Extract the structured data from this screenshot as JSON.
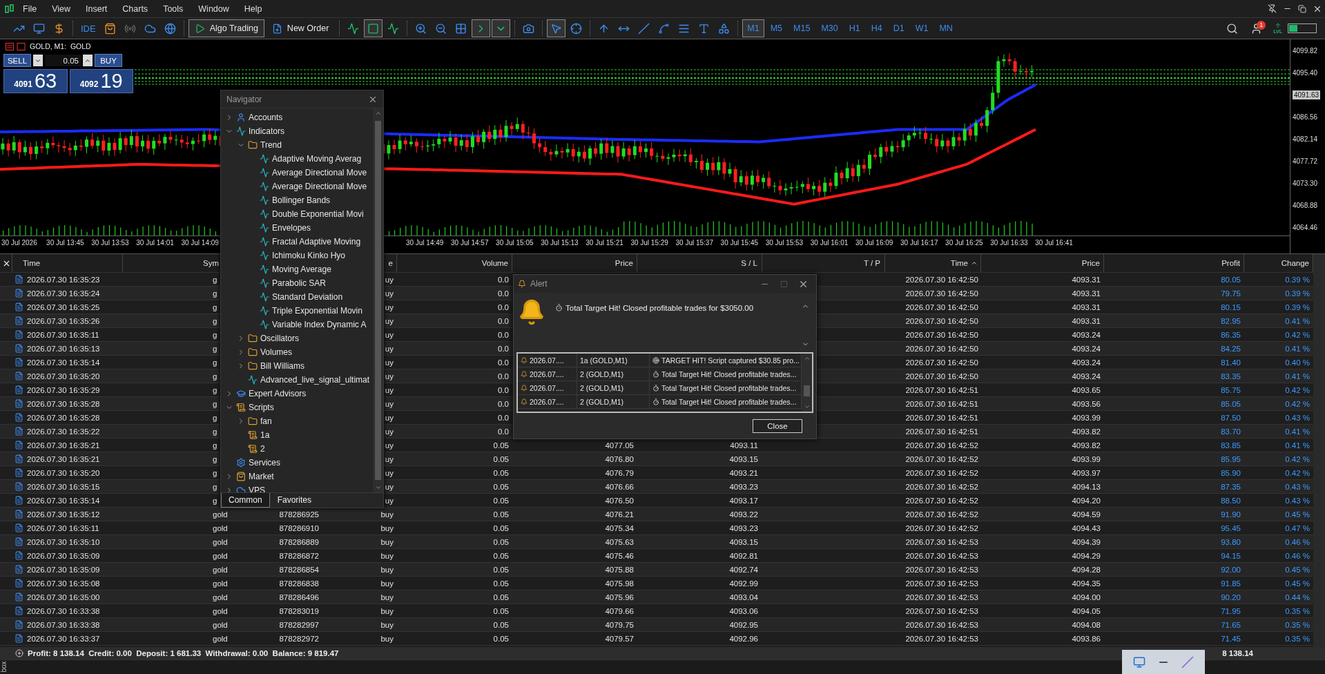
{
  "menu": [
    "File",
    "View",
    "Insert",
    "Charts",
    "Tools",
    "Window",
    "Help"
  ],
  "toolbar": {
    "ide": "IDE",
    "algo_trading": {
      "label": "Algo Trading",
      "on": true
    },
    "new_order": "New Order",
    "toggles": {
      "candles": true,
      "autoscroll": true,
      "chart_shift": true,
      "cursor": true
    },
    "timeframes": [
      {
        "label": "M1",
        "selected": true
      },
      {
        "label": "M5",
        "selected": false
      },
      {
        "label": "M15",
        "selected": false
      },
      {
        "label": "M30",
        "selected": false
      },
      {
        "label": "H1",
        "selected": false
      },
      {
        "label": "H4",
        "selected": false
      },
      {
        "label": "D1",
        "selected": false
      },
      {
        "label": "W1",
        "selected": false
      },
      {
        "label": "MN",
        "selected": false
      }
    ],
    "notifications": "1",
    "lvl": "LVL"
  },
  "chart": {
    "title": "GOLD, M1:  GOLD",
    "trade_panel": {
      "sell": "SELL",
      "buy": "BUY",
      "volume": "0.05",
      "bid_big": "4091",
      "bid_small": "63",
      "ask_big": "4092",
      "ask_small": "19"
    },
    "price_labels": [
      {
        "kind": "tick",
        "text": "4099.82"
      },
      {
        "kind": "tick",
        "text": "4095.40"
      },
      {
        "kind": "current",
        "text": "4091.63"
      },
      {
        "kind": "tick",
        "text": "4086.56"
      },
      {
        "kind": "tick",
        "text": "4082.14"
      },
      {
        "kind": "tick",
        "text": "4077.72"
      },
      {
        "kind": "tick",
        "text": "4073.30"
      },
      {
        "kind": "tick",
        "text": "4068.88"
      },
      {
        "kind": "tick",
        "text": "4064.46"
      }
    ],
    "time_labels": [
      "30 Jul 2026",
      "30 Jul 13:45",
      "30 Jul 13:53",
      "30 Jul 14:01",
      "30 Jul 14:09",
      "30 Jul 14:49",
      "30 Jul 14:57",
      "30 Jul 15:05",
      "30 Jul 15:13",
      "30 Jul 15:21",
      "30 Jul 15:29",
      "30 Jul 15:37",
      "30 Jul 15:45",
      "30 Jul 15:53",
      "30 Jul 16:01",
      "30 Jul 16:09",
      "30 Jul 16:17",
      "30 Jul 16:25",
      "30 Jul 16:33",
      "30 Jul 16:41"
    ]
  },
  "navigator": {
    "title": "Navigator",
    "tabs": [
      {
        "label": "Common",
        "selected": true
      },
      {
        "label": "Favorites",
        "selected": false
      }
    ],
    "items": [
      {
        "label": "Accounts",
        "kind": "accounts",
        "expanded": false
      },
      {
        "label": "Indicators",
        "kind": "indicator",
        "expanded": true,
        "children": [
          {
            "label": "Trend",
            "kind": "folder",
            "expanded": true,
            "children": [
              {
                "label": "Adaptive Moving Averag",
                "kind": "indicator"
              },
              {
                "label": "Average Directional Move",
                "kind": "indicator"
              },
              {
                "label": "Average Directional Move",
                "kind": "indicator"
              },
              {
                "label": "Bollinger Bands",
                "kind": "indicator"
              },
              {
                "label": "Double Exponential Movi",
                "kind": "indicator"
              },
              {
                "label": "Envelopes",
                "kind": "indicator"
              },
              {
                "label": "Fractal Adaptive Moving",
                "kind": "indicator"
              },
              {
                "label": "Ichimoku Kinko Hyo",
                "kind": "indicator"
              },
              {
                "label": "Moving Average",
                "kind": "indicator"
              },
              {
                "label": "Parabolic SAR",
                "kind": "indicator"
              },
              {
                "label": "Standard Deviation",
                "kind": "indicator"
              },
              {
                "label": "Triple Exponential Movin",
                "kind": "indicator"
              },
              {
                "label": "Variable Index Dynamic A",
                "kind": "indicator"
              }
            ]
          },
          {
            "label": "Oscillators",
            "kind": "folder",
            "expanded": false
          },
          {
            "label": "Volumes",
            "kind": "folder",
            "expanded": false
          },
          {
            "label": "Bill Williams",
            "kind": "folder",
            "expanded": false
          },
          {
            "label": "Advanced_live_signal_ultimat",
            "kind": "indicator"
          }
        ]
      },
      {
        "label": "Expert Advisors",
        "kind": "experts",
        "expanded": false
      },
      {
        "label": "Scripts",
        "kind": "script",
        "expanded": true,
        "children": [
          {
            "label": "fan",
            "kind": "folder",
            "expanded": false
          },
          {
            "label": "1a",
            "kind": "script"
          },
          {
            "label": "2",
            "kind": "script"
          }
        ]
      },
      {
        "label": "Services",
        "kind": "services"
      },
      {
        "label": "Market",
        "kind": "market",
        "expanded": false
      },
      {
        "label": "VPS",
        "kind": "vps",
        "expanded": false
      }
    ]
  },
  "alert": {
    "title": "Alert",
    "message": "Total Target Hit! Closed profitable trades for $3050.00",
    "close": "Close",
    "log": [
      {
        "time": "2026.07....",
        "source": "1a (GOLD,M1)",
        "kind": "target",
        "message": "TARGET HIT! Script captured $30.85 pro..."
      },
      {
        "time": "2026.07....",
        "source": "2 (GOLD,M1)",
        "kind": "timer",
        "message": "Total Target Hit! Closed profitable trades..."
      },
      {
        "time": "2026.07....",
        "source": "2 (GOLD,M1)",
        "kind": "timer",
        "message": "Total Target Hit! Closed profitable trades..."
      },
      {
        "time": "2026.07....",
        "source": "2 (GOLD,M1)",
        "kind": "timer",
        "message": "Total Target Hit! Closed profitable trades..."
      }
    ]
  },
  "table": {
    "columns": [
      {
        "label": "Time",
        "sorted": false
      },
      {
        "label": "Sym",
        "sorted": false
      },
      {
        "label": "e",
        "sorted": false
      },
      {
        "label": "Volume",
        "sorted": false
      },
      {
        "label": "Price",
        "sorted": false
      },
      {
        "label": "S / L",
        "sorted": false
      },
      {
        "label": "T / P",
        "sorted": false
      },
      {
        "label": "Time",
        "sorted": true
      },
      {
        "label": "Price",
        "sorted": false
      },
      {
        "label": "Profit",
        "sorted": false
      },
      {
        "label": "Change",
        "sorted": false
      }
    ],
    "rows": [
      {
        "time": "2026.07.30 16:35:23",
        "symbol": "g",
        "type": "uy",
        "volume": "0.0",
        "close_time": "2026.07.30 16:42:50",
        "close_price": "4093.31",
        "profit": "80.05",
        "change": "0.39 %"
      },
      {
        "time": "2026.07.30 16:35:24",
        "symbol": "g",
        "type": "uy",
        "volume": "0.0",
        "close_time": "2026.07.30 16:42:50",
        "close_price": "4093.31",
        "profit": "79.75",
        "change": "0.39 %"
      },
      {
        "time": "2026.07.30 16:35:25",
        "symbol": "g",
        "type": "uy",
        "volume": "0.0",
        "close_time": "2026.07.30 16:42:50",
        "close_price": "4093.31",
        "profit": "80.15",
        "change": "0.39 %"
      },
      {
        "time": "2026.07.30 16:35:26",
        "symbol": "g",
        "type": "uy",
        "volume": "0.0",
        "close_time": "2026.07.30 16:42:50",
        "close_price": "4093.31",
        "profit": "82.95",
        "change": "0.41 %"
      },
      {
        "time": "2026.07.30 16:35:11",
        "symbol": "g",
        "type": "uy",
        "volume": "0.0",
        "close_time": "2026.07.30 16:42:50",
        "close_price": "4093.24",
        "profit": "86.35",
        "change": "0.42 %"
      },
      {
        "time": "2026.07.30 16:35:13",
        "symbol": "g",
        "type": "uy",
        "volume": "0.0",
        "close_time": "2026.07.30 16:42:50",
        "close_price": "4093.24",
        "profit": "84.25",
        "change": "0.41 %"
      },
      {
        "time": "2026.07.30 16:35:14",
        "symbol": "g",
        "type": "uy",
        "volume": "0.0",
        "close_time": "2026.07.30 16:42:50",
        "close_price": "4093.24",
        "profit": "81.40",
        "change": "0.40 %"
      },
      {
        "time": "2026.07.30 16:35:20",
        "symbol": "g",
        "type": "uy",
        "volume": "0.0",
        "close_time": "2026.07.30 16:42:50",
        "close_price": "4093.24",
        "profit": "83.35",
        "change": "0.41 %"
      },
      {
        "time": "2026.07.30 16:35:29",
        "symbol": "g",
        "type": "uy",
        "volume": "0.0",
        "close_time": "2026.07.30 16:42:51",
        "close_price": "4093.65",
        "profit": "85.75",
        "change": "0.42 %"
      },
      {
        "time": "2026.07.30 16:35:28",
        "symbol": "g",
        "type": "uy",
        "volume": "0.0",
        "close_time": "2026.07.30 16:42:51",
        "close_price": "4093.56",
        "profit": "85.05",
        "change": "0.42 %"
      },
      {
        "time": "2026.07.30 16:35:28",
        "symbol": "g",
        "type": "uy",
        "volume": "0.0",
        "close_time": "2026.07.30 16:42:51",
        "close_price": "4093.99",
        "profit": "87.50",
        "change": "0.43 %"
      },
      {
        "time": "2026.07.30 16:35:22",
        "symbol": "g",
        "type": "uy",
        "volume": "0.0",
        "close_time": "2026.07.30 16:42:51",
        "close_price": "4093.82",
        "profit": "83.70",
        "change": "0.41 %"
      },
      {
        "time": "2026.07.30 16:35:21",
        "symbol": "g",
        "type": "uy",
        "volume": "0.05",
        "price": "4077.05",
        "sl": "4093.11",
        "close_time": "2026.07.30 16:42:52",
        "close_price": "4093.82",
        "profit": "83.85",
        "change": "0.41 %"
      },
      {
        "time": "2026.07.30 16:35:21",
        "symbol": "g",
        "type": "uy",
        "volume": "0.05",
        "price": "4076.80",
        "sl": "4093.15",
        "close_time": "2026.07.30 16:42:52",
        "close_price": "4093.99",
        "profit": "85.95",
        "change": "0.42 %"
      },
      {
        "time": "2026.07.30 16:35:20",
        "symbol": "g",
        "type": "uy",
        "volume": "0.05",
        "price": "4076.79",
        "sl": "4093.21",
        "close_time": "2026.07.30 16:42:52",
        "close_price": "4093.97",
        "profit": "85.90",
        "change": "0.42 %"
      },
      {
        "time": "2026.07.30 16:35:15",
        "symbol": "g",
        "type": "uy",
        "volume": "0.05",
        "price": "4076.66",
        "sl": "4093.23",
        "close_time": "2026.07.30 16:42:52",
        "close_price": "4094.13",
        "profit": "87.35",
        "change": "0.43 %"
      },
      {
        "time": "2026.07.30 16:35:14",
        "symbol": "g",
        "type": "uy",
        "volume": "0.05",
        "price": "4076.50",
        "sl": "4093.17",
        "close_time": "2026.07.30 16:42:52",
        "close_price": "4094.20",
        "profit": "88.50",
        "change": "0.43 %"
      },
      {
        "time": "2026.07.30 16:35:12",
        "symbol": "gold",
        "ticket": "878286925",
        "type": "buy",
        "volume": "0.05",
        "price": "4076.21",
        "sl": "4093.22",
        "close_time": "2026.07.30 16:42:52",
        "close_price": "4094.59",
        "profit": "91.90",
        "change": "0.45 %"
      },
      {
        "time": "2026.07.30 16:35:11",
        "symbol": "gold",
        "ticket": "878286910",
        "type": "buy",
        "volume": "0.05",
        "price": "4075.34",
        "sl": "4093.23",
        "close_time": "2026.07.30 16:42:52",
        "close_price": "4094.43",
        "profit": "95.45",
        "change": "0.47 %"
      },
      {
        "time": "2026.07.30 16:35:10",
        "symbol": "gold",
        "ticket": "878286889",
        "type": "buy",
        "volume": "0.05",
        "price": "4075.63",
        "sl": "4093.15",
        "close_time": "2026.07.30 16:42:53",
        "close_price": "4094.39",
        "profit": "93.80",
        "change": "0.46 %"
      },
      {
        "time": "2026.07.30 16:35:09",
        "symbol": "gold",
        "ticket": "878286872",
        "type": "buy",
        "volume": "0.05",
        "price": "4075.46",
        "sl": "4092.81",
        "close_time": "2026.07.30 16:42:53",
        "close_price": "4094.29",
        "profit": "94.15",
        "change": "0.46 %"
      },
      {
        "time": "2026.07.30 16:35:09",
        "symbol": "gold",
        "ticket": "878286854",
        "type": "buy",
        "volume": "0.05",
        "price": "4075.88",
        "sl": "4092.74",
        "close_time": "2026.07.30 16:42:53",
        "close_price": "4094.28",
        "profit": "92.00",
        "change": "0.45 %"
      },
      {
        "time": "2026.07.30 16:35:08",
        "symbol": "gold",
        "ticket": "878286838",
        "type": "buy",
        "volume": "0.05",
        "price": "4075.98",
        "sl": "4092.99",
        "close_time": "2026.07.30 16:42:53",
        "close_price": "4094.35",
        "profit": "91.85",
        "change": "0.45 %"
      },
      {
        "time": "2026.07.30 16:35:00",
        "symbol": "gold",
        "ticket": "878286496",
        "type": "buy",
        "volume": "0.05",
        "price": "4075.96",
        "sl": "4093.04",
        "close_time": "2026.07.30 16:42:53",
        "close_price": "4094.00",
        "profit": "90.20",
        "change": "0.44 %"
      },
      {
        "time": "2026.07.30 16:33:38",
        "symbol": "gold",
        "ticket": "878283019",
        "type": "buy",
        "volume": "0.05",
        "price": "4079.66",
        "sl": "4093.06",
        "close_time": "2026.07.30 16:42:53",
        "close_price": "4094.05",
        "profit": "71.95",
        "change": "0.35 %"
      },
      {
        "time": "2026.07.30 16:33:38",
        "symbol": "gold",
        "ticket": "878282997",
        "type": "buy",
        "volume": "0.05",
        "price": "4079.75",
        "sl": "4092.95",
        "close_time": "2026.07.30 16:42:53",
        "close_price": "4094.08",
        "profit": "71.65",
        "change": "0.35 %"
      },
      {
        "time": "2026.07.30 16:33:37",
        "symbol": "gold",
        "ticket": "878282972",
        "type": "buy",
        "volume": "0.05",
        "price": "4079.57",
        "sl": "4092.96",
        "close_time": "2026.07.30 16:42:53",
        "close_price": "4093.86",
        "profit": "71.45",
        "change": "0.35 %"
      }
    ]
  },
  "status_bar": {
    "summary": "Profit: 8 138.14  Credit: 0.00  Deposit: 1 681.33  Withdrawal: 0.00  Balance: 9 819.47",
    "total": "8 138.14",
    "side_tab": "box"
  }
}
